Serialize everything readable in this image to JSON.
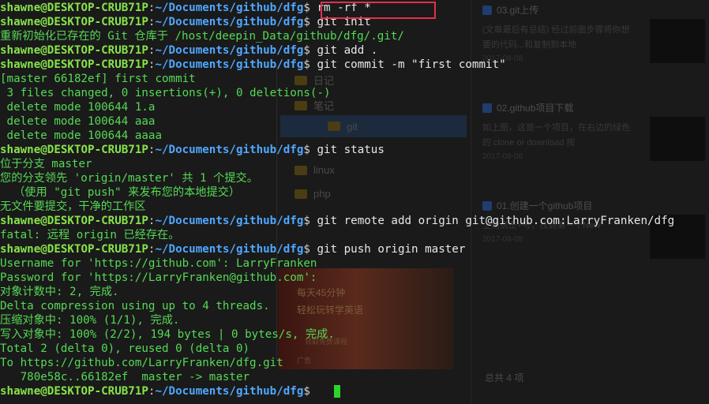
{
  "background_window": {
    "tree": [
      {
        "label": "日记",
        "selected": false
      },
      {
        "label": "笔记",
        "selected": false
      },
      {
        "label": "git",
        "selected": true
      },
      {
        "label": "linux",
        "selected": false
      },
      {
        "label": "php",
        "selected": false
      }
    ],
    "articles": [
      {
        "title": "03.git上传",
        "summary": "(文章最后有总结) 经过前面步骤将你想要的代码...和复制到本地",
        "date": "2017-08-08"
      },
      {
        "title": "02.github项目下载",
        "summary": "如上图，这是一个项目，在右边的绿色的 clone or download 按",
        "date": "2017-08-08"
      },
      {
        "title": "01.创建一个github项目",
        "summary": "上角点击+号，找到第一个New",
        "date": "2017-08-08"
      }
    ],
    "total_label": "总共 4 项",
    "ad": {
      "line1": "每天45分钟",
      "line2": "轻松玩转学英语",
      "line3": "领取免费课程",
      "line4": "广告"
    }
  },
  "terminal": {
    "prompt": {
      "user_host": "shawne@DESKTOP-CRUB71P",
      "path": "~/Documents/github/dfg"
    },
    "lines": [
      {
        "type": "cmd",
        "text": " rm -rf *"
      },
      {
        "type": "cmd",
        "text": " git init"
      },
      {
        "type": "out",
        "text": "重新初始化已存在的 Git 仓库于 /host/deepin_Data/github/dfg/.git/"
      },
      {
        "type": "cmd",
        "text": " git add ."
      },
      {
        "type": "cmd",
        "text": " git commit -m \"first commit\""
      },
      {
        "type": "out",
        "text": "[master 66182ef] first commit"
      },
      {
        "type": "out",
        "text": " 3 files changed, 0 insertions(+), 0 deletions(-)"
      },
      {
        "type": "out",
        "text": " delete mode 100644 1.a"
      },
      {
        "type": "out",
        "text": " delete mode 100644 aaa"
      },
      {
        "type": "out",
        "text": " delete mode 100644 aaaa"
      },
      {
        "type": "cmd",
        "text": " git status"
      },
      {
        "type": "out",
        "text": "位于分支 master"
      },
      {
        "type": "out",
        "text": "您的分支领先 'origin/master' 共 1 个提交。"
      },
      {
        "type": "out",
        "text": "  （使用 \"git push\" 来发布您的本地提交）"
      },
      {
        "type": "out",
        "text": "无文件要提交，干净的工作区"
      },
      {
        "type": "cmd",
        "text": " git remote add origin git@github.com:LarryFranken/dfg"
      },
      {
        "type": "out",
        "text": "fatal: 远程 origin 已经存在。"
      },
      {
        "type": "cmd",
        "text": " git push origin master"
      },
      {
        "type": "out",
        "text": "Username for 'https://github.com': LarryFranken"
      },
      {
        "type": "out",
        "text": "Password for 'https://LarryFranken@github.com':"
      },
      {
        "type": "out",
        "text": "对象计数中: 2, 完成."
      },
      {
        "type": "out",
        "text": "Delta compression using up to 4 threads."
      },
      {
        "type": "out",
        "text": "压缩对象中: 100% (1/1), 完成."
      },
      {
        "type": "out",
        "text": "写入对象中: 100% (2/2), 194 bytes | 0 bytes/s, 完成."
      },
      {
        "type": "out",
        "text": "Total 2 (delta 0), reused 0 (delta 0)"
      },
      {
        "type": "out",
        "text": "To https://github.com/LarryFranken/dfg.git"
      },
      {
        "type": "out",
        "text": "   780e58c..66182ef  master -> master"
      },
      {
        "type": "cmd",
        "text": ""
      }
    ],
    "highlighted_command": "rm -rf *",
    "colors": {
      "user_host": "#87e34b",
      "path": "#4fa7ff",
      "output": "#55d955",
      "command": "#e8e8e8",
      "highlight_box": "#e0304c",
      "cursor": "#2bd52b"
    }
  }
}
